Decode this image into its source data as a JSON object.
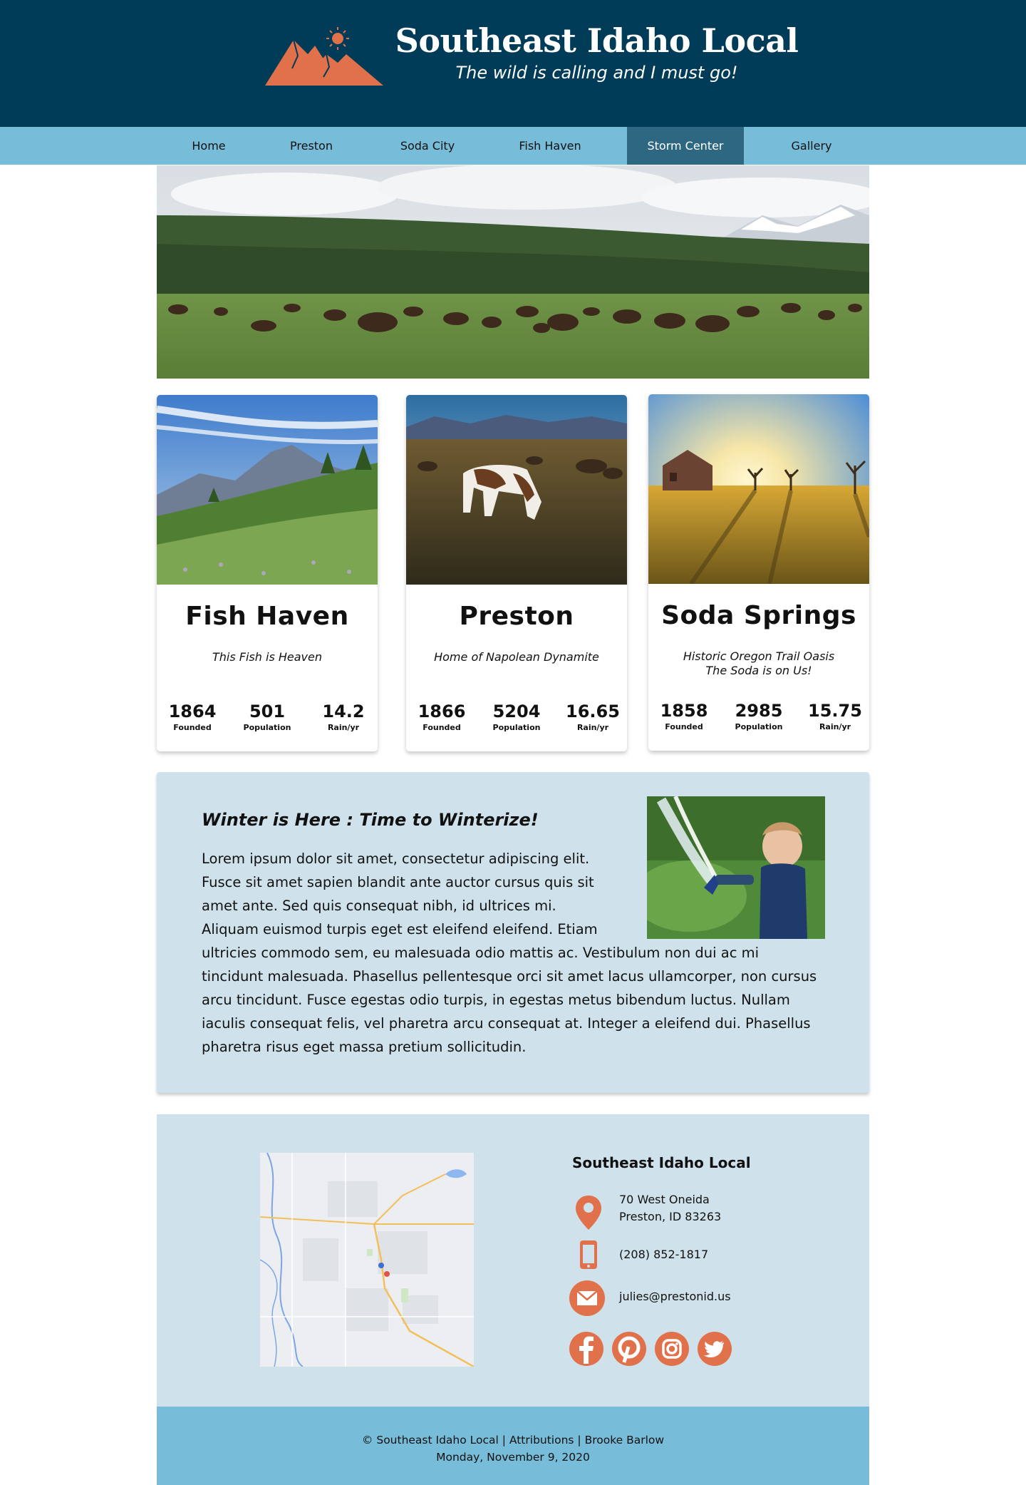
{
  "header": {
    "title": "Southeast Idaho Local",
    "tagline": "The wild is calling and I must go!",
    "logo_icon": "mountain-sun-logo"
  },
  "nav": {
    "items": [
      {
        "label": "Home"
      },
      {
        "label": "Preston"
      },
      {
        "label": "Soda City"
      },
      {
        "label": "Fish Haven"
      },
      {
        "label": "Storm Center",
        "active": true
      },
      {
        "label": "Gallery"
      }
    ]
  },
  "hero": {
    "image": "bison-herd-meadow-photo"
  },
  "cards": [
    {
      "title": "Fish Haven",
      "motto": "This Fish is Heaven",
      "image": "mountain-meadow-photo",
      "stats": [
        {
          "value": "1864",
          "label": "Founded"
        },
        {
          "value": "501",
          "label": "Population"
        },
        {
          "value": "14.2",
          "label": "Rain/yr"
        }
      ]
    },
    {
      "title": "Preston",
      "motto": "Home of Napolean Dynamite",
      "image": "grazing-horses-photo",
      "stats": [
        {
          "value": "1866",
          "label": "Founded"
        },
        {
          "value": "5204",
          "label": "Population"
        },
        {
          "value": "16.65",
          "label": "Rain/yr"
        }
      ]
    },
    {
      "title": "Soda Springs",
      "motto_lines": [
        "Historic Oregon Trail Oasis",
        "The Soda is on Us!"
      ],
      "image": "sunset-field-barn-photo",
      "stats": [
        {
          "value": "1858",
          "label": "Founded"
        },
        {
          "value": "2985",
          "label": "Population"
        },
        {
          "value": "15.75",
          "label": "Rain/yr"
        }
      ]
    }
  ],
  "storm": {
    "title": "Winter is Here : Time to Winterize!",
    "body": "Lorem ipsum dolor sit amet, consectetur adipiscing elit. Fusce sit amet sapien blandit ante auctor cursus quis sit amet ante. Sed quis consequat nibh, id ultrices mi. Aliquam euismod turpis eget est eleifend eleifend. Etiam ultricies commodo sem, eu malesuada odio mattis ac. Vestibulum non dui ac mi tincidunt malesuada. Phasellus pellentesque orci sit amet lacus ullamcorper, non cursus arcu tincidunt. Fusce egestas odio turpis, in egestas metus bibendum luctus. Nullam iaculis consequat felis, vel pharetra arcu consequat at. Integer a eleifend dui. Phasellus pharetra risus eget massa pretium sollicitudin.",
    "image": "child-garden-hose-photo"
  },
  "contact": {
    "name": "Southeast Idaho Local",
    "address_line1": "70 West Oneida",
    "address_line2": "Preston, ID 83263",
    "phone": "(208) 852-1817",
    "email": "julies@prestonid.us",
    "icons": [
      "location-pin-icon",
      "phone-icon",
      "email-icon"
    ],
    "social": [
      "facebook-icon",
      "pinterest-icon",
      "instagram-icon",
      "twitter-icon"
    ],
    "map": "preston-area-map",
    "accent": "#e0714a"
  },
  "footer": {
    "line1": "© Southeast Idaho Local | Attributions | Brooke Barlow",
    "line2": "Monday, November 9, 2020"
  },
  "colors": {
    "header_bg": "#003b57",
    "nav_bg": "#77bcd8",
    "nav_active": "#2d6781",
    "panel_bg": "#cfe2eb",
    "accent": "#e0714a"
  }
}
